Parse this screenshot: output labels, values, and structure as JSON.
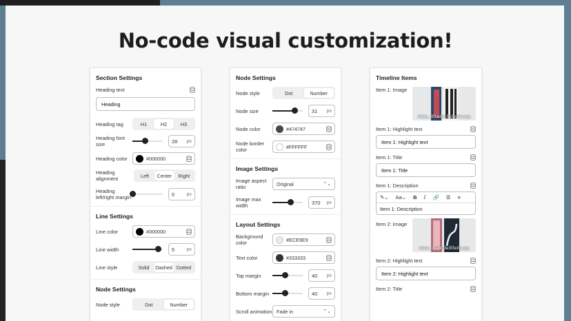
{
  "headline": "No-code visual customization!",
  "colors": {
    "bg_blue": "#5e7f92",
    "bg_dark": "#242424",
    "canvas": "#f7f7f7",
    "knob": "#222222"
  },
  "panel1": {
    "section_title": "Section Settings",
    "heading_text_label": "Heading text",
    "heading_text_value": "Heading",
    "heading_tag_label": "Heading tag",
    "heading_tag_options": [
      "H1",
      "H2",
      "H3"
    ],
    "heading_tag_selected": "H2",
    "heading_font_size_label": "Heading font size",
    "heading_font_size_value": "28",
    "heading_font_size_fraction": 0.4,
    "heading_color_label": "Heading color",
    "heading_color_value": "#000000",
    "heading_alignment_label": "Heading alignment",
    "heading_alignment_options": [
      "Left",
      "Center",
      "Right"
    ],
    "heading_alignment_selected": "Center",
    "heading_margin_label": "Heading left/right margin",
    "heading_margin_value": "0",
    "heading_margin_fraction": 0.0,
    "unit_px": "px",
    "line_title": "Line Settings",
    "line_color_label": "Line color",
    "line_color_value": "#000000",
    "line_width_label": "Line width",
    "line_width_value": "5",
    "line_width_fraction": 0.85,
    "line_style_label": "Line style",
    "line_style_options": [
      "Solid",
      "Dashed",
      "Dotted"
    ],
    "line_style_selected": "Dashed",
    "node_title": "Node Settings",
    "node_style_label": "Node style",
    "node_style_options": [
      "Dot",
      "Number"
    ],
    "node_style_selected": "Number"
  },
  "panel2": {
    "node_title": "Node Settings",
    "node_style_label": "Node style",
    "node_style_options": [
      "Dot",
      "Number"
    ],
    "node_style_selected": "Number",
    "node_size_label": "Node size",
    "node_size_value": "31",
    "node_size_fraction": 0.72,
    "node_color_label": "Node color",
    "node_color_value": "#474747",
    "node_border_color_label": "Node border color",
    "node_border_color_value": "#FFFFFF",
    "unit_px": "px",
    "image_title": "Image Settings",
    "image_aspect_label": "Image aspect ratio",
    "image_aspect_value": "Original",
    "image_max_width_label": "Image max width",
    "image_max_width_value": "370",
    "image_max_width_fraction": 0.6,
    "layout_title": "Layout Settings",
    "bg_color_label": "Background color",
    "bg_color_value": "#ECE9E9",
    "text_color_label": "Text color",
    "text_color_value": "#333333",
    "top_margin_label": "Top margin",
    "top_margin_value": "40",
    "top_margin_fraction": 0.4,
    "bottom_margin_label": "Bottom margin",
    "bottom_margin_value": "40",
    "bottom_margin_fraction": 0.4,
    "scroll_animation_label": "Scroll animation",
    "scroll_animation_value": "Fade in"
  },
  "panel3": {
    "title": "Timeline Items",
    "item1_image_label": "Item 1: Image",
    "item1_image_caption": "Mate_3f3ade43a3ea6a.jpg",
    "item1_highlight_label": "Item 1: Highlight text",
    "item1_highlight_value": "Item 1: Highlight text",
    "item1_title_label": "Item 1: Title",
    "item1_title_value": "Item 1: Title",
    "item1_desc_label": "Item 1: Description",
    "item1_desc_value": "Item 1: Description",
    "editor_tools": [
      "Aa",
      "B",
      "I"
    ],
    "item2_image_label": "Item 2: Image",
    "item2_image_caption": "Mate_3624ff3e3f3e0b.jpg",
    "item2_highlight_label": "Item 2: Highlight text",
    "item2_highlight_value": "Item 2: Highlight text",
    "item2_title_label": "Item 2: Title"
  }
}
